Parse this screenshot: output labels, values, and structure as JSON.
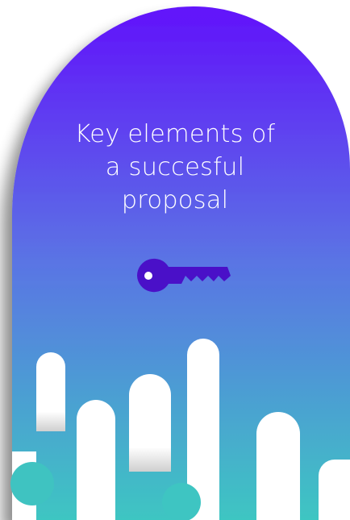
{
  "card": {
    "title": "Key elements of\na succesful\nproposal",
    "icon": "key-icon"
  },
  "colors": {
    "gradient_top": "#6212fb",
    "gradient_mid": "#5a75e4",
    "gradient_bottom": "#3ec6c2",
    "icon": "#4a10c8",
    "title_text": "#ffffff",
    "background": "#ffffff"
  }
}
